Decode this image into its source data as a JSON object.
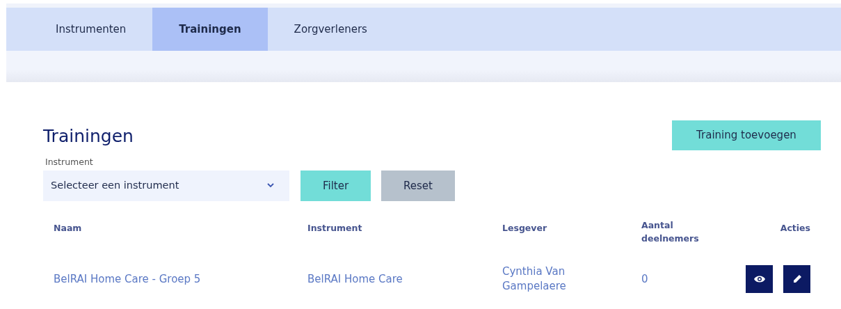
{
  "tabs": [
    {
      "label": "Instrumenten",
      "selected": false
    },
    {
      "label": "Trainingen",
      "selected": true
    },
    {
      "label": "Zorgverleners",
      "selected": false
    }
  ],
  "heading": "Trainingen",
  "add_button": "Training toevoegen",
  "filter": {
    "label": "Instrument",
    "value": "Selecteer een instrument",
    "filter_button": "Filter",
    "reset_button": "Reset"
  },
  "table": {
    "columns": [
      "Naam",
      "Instrument",
      "Lesgever",
      "Aantal deelnemers",
      "Acties"
    ],
    "rows": [
      {
        "naam": "BelRAI Home Care - Groep 5",
        "instrument": "BelRAI Home Care",
        "lesgever": "Cynthia Van Gampelaere",
        "aantal": "0"
      }
    ]
  }
}
